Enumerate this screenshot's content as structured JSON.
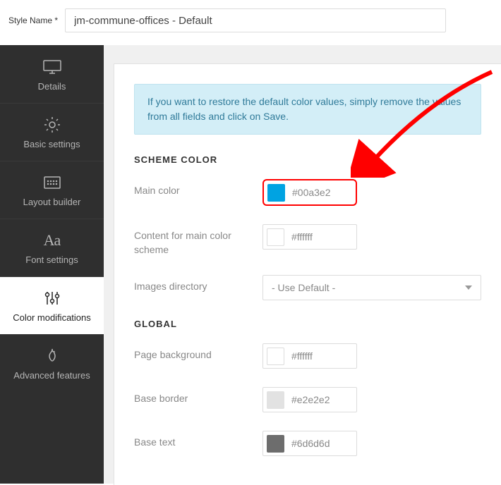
{
  "top": {
    "label": "Style Name *",
    "value": "jm-commune-offices - Default"
  },
  "sidebar": {
    "items": [
      {
        "label": "Details",
        "icon": "monitor-icon"
      },
      {
        "label": "Basic settings",
        "icon": "gear-icon"
      },
      {
        "label": "Layout builder",
        "icon": "grid-icon"
      },
      {
        "label": "Font settings",
        "icon": "font-aa"
      },
      {
        "label": "Color modifications",
        "icon": "sliders-icon",
        "active": true
      },
      {
        "label": "Advanced features",
        "icon": "flame-icon"
      }
    ]
  },
  "panel": {
    "notice": "If you want to restore the default color values, simply remove the values from all fields and click on Save.",
    "sections": {
      "scheme": {
        "title": "SCHEME COLOR",
        "main_color_label": "Main color",
        "main_color_value": "#00a3e2",
        "content_label": "Content for main color scheme",
        "content_value": "#ffffff",
        "images_dir_label": "Images directory",
        "images_dir_value": "- Use Default -"
      },
      "global": {
        "title": "GLOBAL",
        "page_bg_label": "Page background",
        "page_bg_value": "#ffffff",
        "base_border_label": "Base border",
        "base_border_value": "#e2e2e2",
        "base_text_label": "Base text",
        "base_text_value": "#6d6d6d"
      }
    }
  },
  "colors": {
    "main": "#00a3e2",
    "content": "#ffffff",
    "page_bg": "#ffffff",
    "base_border": "#e2e2e2",
    "base_text": "#6d6d6d"
  }
}
